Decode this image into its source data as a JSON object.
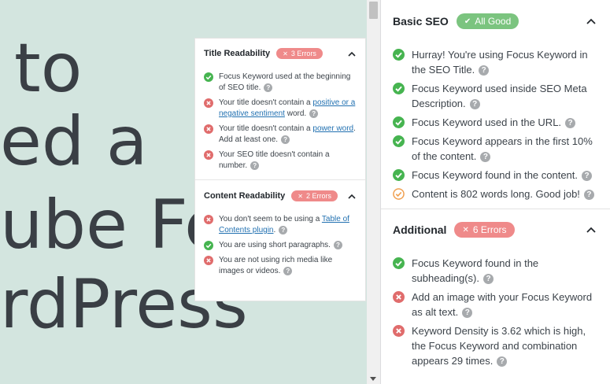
{
  "hero": {
    "lines": [
      "to",
      "ed a",
      "ube Fe",
      "rdPress"
    ]
  },
  "left_panel": {
    "title_readability": {
      "title": "Title Readability",
      "badge": "3 Errors",
      "items": [
        {
          "status": "good",
          "text": "Focus Keyword used at the beginning of SEO title."
        },
        {
          "status": "error",
          "pre": "Your title doesn't contain a ",
          "link": "positive or a negative sentiment",
          "post": " word."
        },
        {
          "status": "error",
          "pre": "Your title doesn't contain a ",
          "link": "power word",
          "post": ". Add at least one."
        },
        {
          "status": "error",
          "text": "Your SEO title doesn't contain a number."
        }
      ]
    },
    "content_readability": {
      "title": "Content Readability",
      "badge": "2 Errors",
      "items": [
        {
          "status": "error",
          "pre": "You don't seem to be using a ",
          "link": "Table of Contents plugin",
          "post": "."
        },
        {
          "status": "good",
          "text": "You are using short paragraphs."
        },
        {
          "status": "error",
          "text": "You are not using rich media like images or videos."
        }
      ]
    }
  },
  "right_panel": {
    "basic_seo": {
      "title": "Basic SEO",
      "badge": "All Good",
      "items": [
        {
          "status": "good",
          "text": "Hurray! You're using Focus Keyword in the SEO Title."
        },
        {
          "status": "good",
          "text": "Focus Keyword used inside SEO Meta Description."
        },
        {
          "status": "good",
          "text": "Focus Keyword used in the URL."
        },
        {
          "status": "good",
          "text": "Focus Keyword appears in the first 10% of the content."
        },
        {
          "status": "good",
          "text": "Focus Keyword found in the content."
        },
        {
          "status": "warn",
          "text": "Content is 802 words long. Good job!"
        }
      ]
    },
    "additional": {
      "title": "Additional",
      "badge": "6 Errors",
      "items": [
        {
          "status": "good",
          "text": "Focus Keyword found in the subheading(s)."
        },
        {
          "status": "error",
          "text": "Add an image with your Focus Keyword as alt text."
        },
        {
          "status": "error",
          "text": "Keyword Density is 3.62 which is high, the Focus Keyword and combination appears 29 times."
        }
      ]
    }
  },
  "colors": {
    "good": "#46b450",
    "error": "#e06c6c",
    "warn": "#f0a050",
    "help": "#a7aaad",
    "link": "#2271b1",
    "hero_bg": "#d3e5df"
  }
}
